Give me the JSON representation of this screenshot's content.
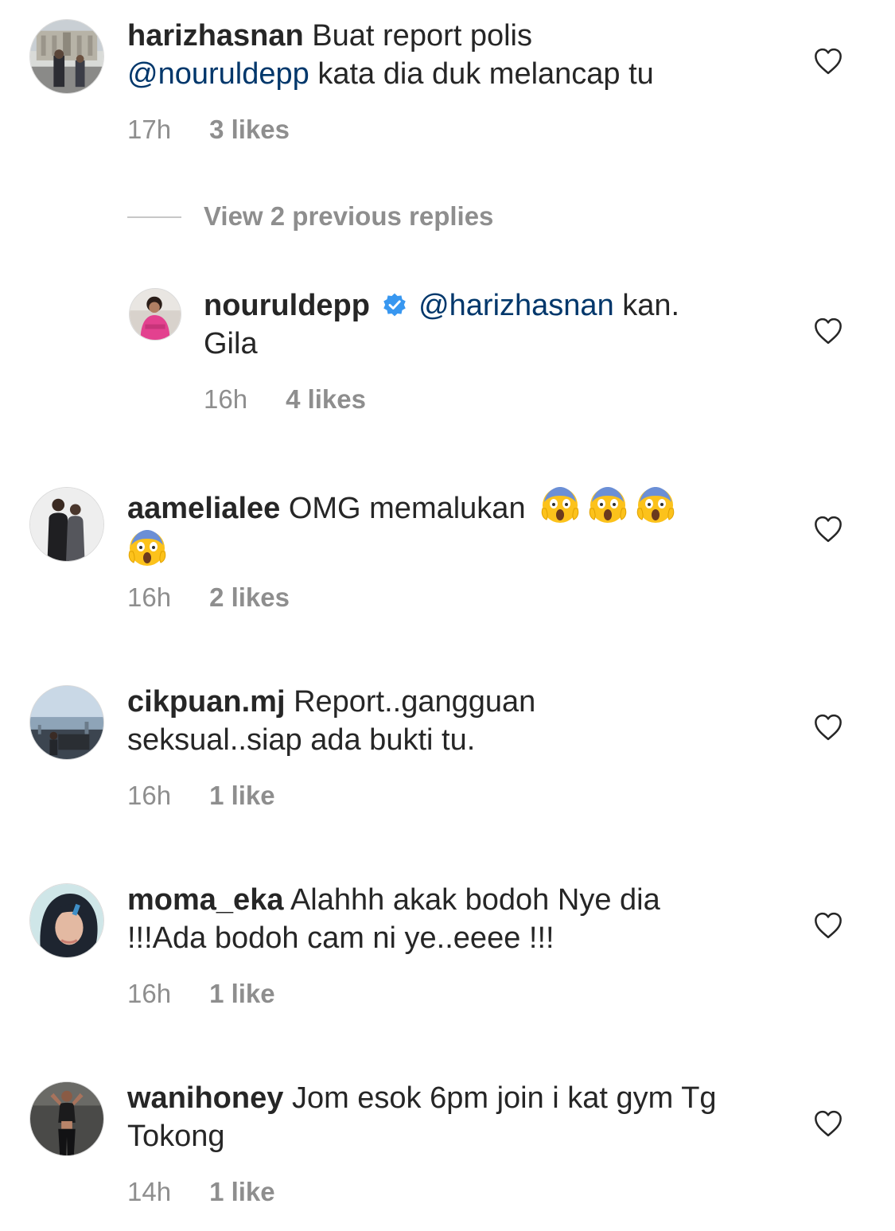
{
  "comments": [
    {
      "username": "harizhasnan",
      "text_before": "Buat report polis",
      "mention": "@nouruldepp",
      "text_after": "kata dia duk melancap tu",
      "time": "17h",
      "likes": "3 likes",
      "avatar_icon": "avatar-photo-building"
    },
    {
      "username": "aamelialee",
      "text": "OMG memalukan",
      "emoji_icon": "face-screaming-in-fear-emoji",
      "emoji_count": 4,
      "time": "16h",
      "likes": "2 likes",
      "avatar_icon": "avatar-photo-couple"
    },
    {
      "username": "cikpuan.mj",
      "text": "Report..gangguan seksual..siap ada bukti tu.",
      "time": "16h",
      "likes": "1 like",
      "avatar_icon": "avatar-photo-city-view"
    },
    {
      "username": "moma_eka",
      "text": "Alahhh akak bodoh Nye dia !!!Ada bodoh cam ni ye..eeee !!!",
      "time": "16h",
      "likes": "1 like",
      "avatar_icon": "avatar-photo-portrait"
    },
    {
      "username": "wanihoney",
      "text": "Jom esok 6pm join i kat gym Tg Tokong",
      "time": "14h",
      "likes": "1 like",
      "avatar_icon": "avatar-photo-fitness"
    }
  ],
  "replies_toggle": {
    "label": "View 2 previous replies"
  },
  "reply": {
    "username": "nouruldepp",
    "verified": true,
    "mention": "@harizhasnan",
    "text": "kan. Gila",
    "time": "16h",
    "likes": "4 likes",
    "avatar_icon": "avatar-photo-pink"
  },
  "icons": {
    "like": "heart-outline-icon",
    "verified": "verified-badge-icon"
  },
  "colors": {
    "text": "#262626",
    "secondary": "#8e8e8e",
    "mention": "#00376b",
    "verified": "#3897f0",
    "background": "#ffffff"
  }
}
